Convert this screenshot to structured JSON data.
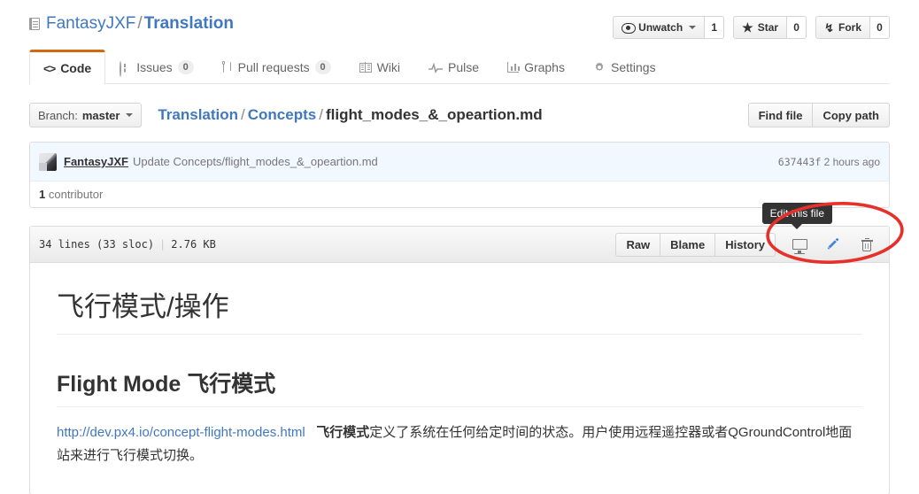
{
  "repo": {
    "owner": "FantasyJXF",
    "separator": "/",
    "name": "Translation",
    "icon": "repo-book-icon"
  },
  "actions": {
    "watch": {
      "label": "Unwatch",
      "count": "1",
      "icon": "eye-icon"
    },
    "star": {
      "label": "Star",
      "count": "0",
      "icon": "star-icon"
    },
    "fork": {
      "label": "Fork",
      "count": "0",
      "icon": "repo-forked-icon"
    }
  },
  "nav": {
    "items": [
      {
        "label": "Code",
        "count": null,
        "icon": "code-icon",
        "selected": true
      },
      {
        "label": "Issues",
        "count": "0",
        "icon": "issue-opened-icon",
        "selected": false
      },
      {
        "label": "Pull requests",
        "count": "0",
        "icon": "git-pull-request-icon",
        "selected": false
      },
      {
        "label": "Wiki",
        "count": null,
        "icon": "book-icon",
        "selected": false
      },
      {
        "label": "Pulse",
        "count": null,
        "icon": "pulse-icon",
        "selected": false
      },
      {
        "label": "Graphs",
        "count": null,
        "icon": "graph-icon",
        "selected": false
      },
      {
        "label": "Settings",
        "count": null,
        "icon": "gear-icon",
        "selected": false
      }
    ]
  },
  "file_nav": {
    "branch_prefix": "Branch:",
    "branch_name": "master",
    "breadcrumb": {
      "root": "Translation",
      "folder": "Concepts",
      "filename": "flight_modes_&_opeartion.md",
      "slash": "/"
    },
    "find_file": "Find file",
    "copy_path": "Copy path"
  },
  "commit": {
    "author": "FantasyJXF",
    "message": "Update Concepts/flight_modes_&_opeartion.md",
    "sha": "637443f",
    "time": "2 hours ago",
    "contributors_count": "1",
    "contributors_label": "contributor"
  },
  "blob": {
    "lines": "34 lines (33 sloc)",
    "divider": "|",
    "size": "2.76 KB",
    "raw": "Raw",
    "blame": "Blame",
    "history": "History",
    "desktop_icon": "device-desktop-icon",
    "edit_icon": "pencil-icon",
    "delete_icon": "trashcan-icon",
    "tooltip": "Edit this file"
  },
  "content": {
    "h1": "飞行模式/操作",
    "h2": "Flight Mode 飞行模式",
    "paragraph": {
      "link_text": "http://dev.px4.io/concept-flight-modes.html",
      "bold_text": "飞行模式",
      "rest_text": "定义了系统在任何给定时间的状态。用户使用远程遥控器或者QGroundControl地面站来进行飞行模式切换。"
    }
  },
  "colors": {
    "link": "#4078c0",
    "accent_tab": "#d26911",
    "annotation": "#e8302a",
    "commit_bg": "#f1f8ff"
  }
}
